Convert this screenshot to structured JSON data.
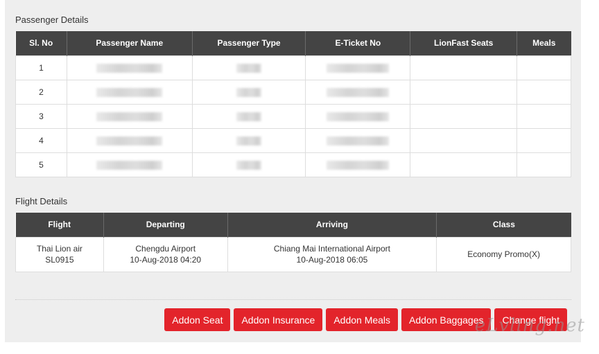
{
  "passenger_section": {
    "title": "Passenger Details",
    "columns": [
      "Sl. No",
      "Passenger Name",
      "Passenger Type",
      "E-Ticket No",
      "LionFast Seats",
      "Meals"
    ],
    "rows": [
      {
        "sl": "1",
        "seat": "",
        "meal": ""
      },
      {
        "sl": "2",
        "seat": "",
        "meal": ""
      },
      {
        "sl": "3",
        "seat": "",
        "meal": ""
      },
      {
        "sl": "4",
        "seat": "",
        "meal": ""
      },
      {
        "sl": "5",
        "seat": "",
        "meal": ""
      }
    ]
  },
  "flight_section": {
    "title": "Flight Details",
    "columns": [
      "Flight",
      "Departing",
      "Arriving",
      "Class"
    ],
    "flight": {
      "airline": "Thai Lion air",
      "number": "SL0915",
      "departing_airport": "Chengdu Airport",
      "departing_time": "10-Aug-2018 04:20",
      "arriving_airport": "Chiang Mai International Airport",
      "arriving_time": "10-Aug-2018 06:05",
      "class": "Economy Promo(X)"
    }
  },
  "actions": {
    "addon_seat": "Addon Seat",
    "addon_insurance": "Addon Insurance",
    "addon_meals": "Addon Meals",
    "addon_baggages": "Addon Baggages",
    "change_flight": "Change flight"
  },
  "watermark": "eLvling.net",
  "colors": {
    "header_bg": "#444444",
    "button_bg": "#e3242b",
    "panel_bg": "#eeeeee"
  }
}
